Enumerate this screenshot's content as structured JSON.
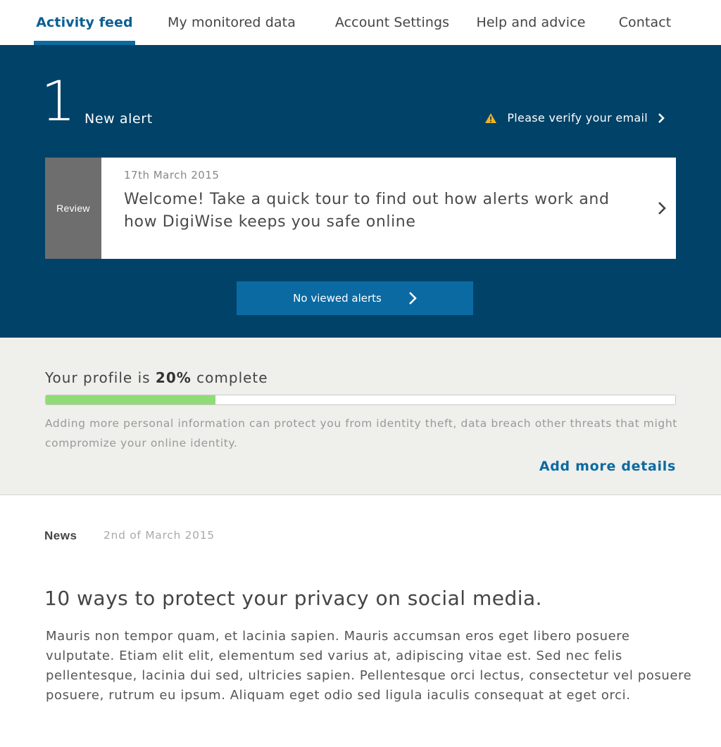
{
  "nav": {
    "tabs": [
      {
        "label": "Activity feed",
        "active": true
      },
      {
        "label": "My monitored data",
        "active": false
      },
      {
        "label": "Account Settings",
        "active": false
      },
      {
        "label": "Help and advice",
        "active": false
      },
      {
        "label": "Contact",
        "active": false
      }
    ]
  },
  "alerts": {
    "count": "1",
    "count_label": "New alert",
    "verify_text": "Please verify your email",
    "verify_icon": "warning-icon",
    "card": {
      "tag": "Review",
      "date": "17th March 2015",
      "title": "Welcome! Take a quick tour to find out how alerts work and how DigiWise keeps you safe online"
    },
    "viewed_button": "No viewed alerts"
  },
  "profile": {
    "prefix": "Your profile is",
    "percent_text": "20%",
    "suffix": "complete",
    "progress_fraction": 0.27,
    "description": "Adding more personal information can protect you from identity theft, data breach other threats that might compromize your online identity.",
    "add_more": "Add more details"
  },
  "news": {
    "tag": "News",
    "date": "2nd of March 2015",
    "title": "10 ways to protect your privacy on social media.",
    "body": "Mauris non tempor quam, et lacinia sapien. Mauris accumsan eros eget libero posuere vulputate. Etiam elit elit, elementum sed varius at, adipiscing vitae est. Sed nec felis pellentesque, lacinia dui sed, ultricies sapien. Pellentesque orci lectus, consectetur vel posuere posuere, rutrum eu ipsum. Aliquam eget odio sed ligula iaculis consequat at eget orci."
  },
  "colors": {
    "brand_dark": "#004268",
    "accent_blue": "#0b6aa2",
    "progress_green": "#8fdc76",
    "warning_yellow": "#f2b322",
    "review_gray": "#6e6e6e"
  }
}
